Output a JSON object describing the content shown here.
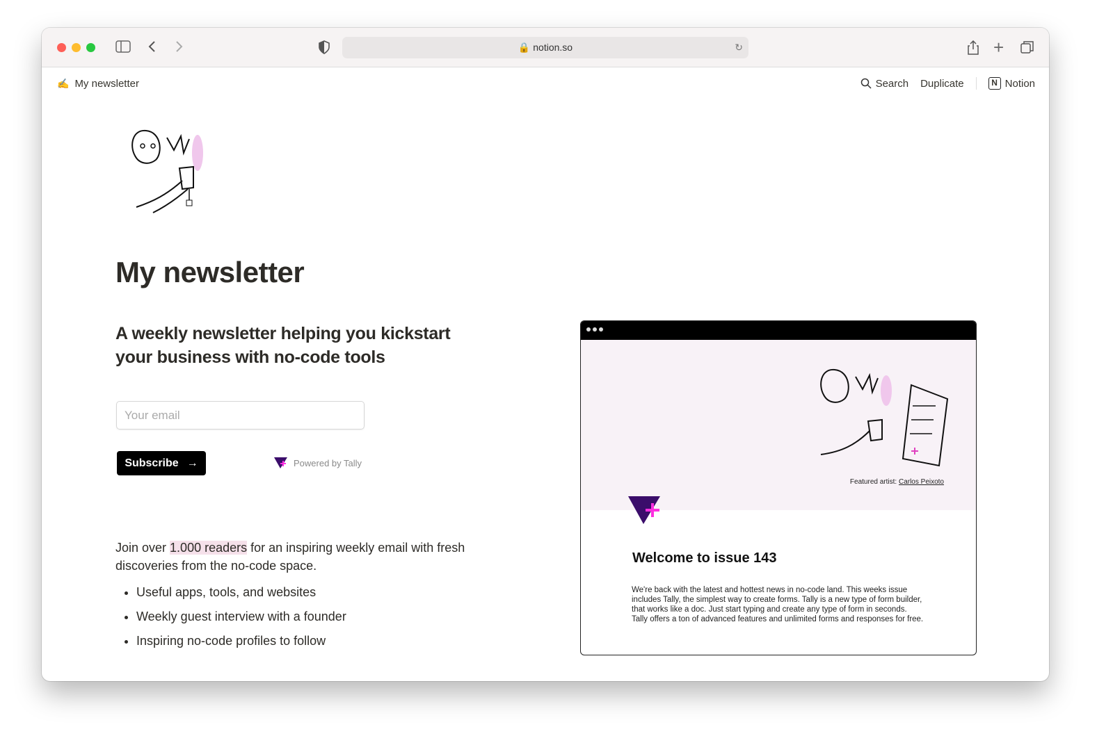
{
  "browser": {
    "url": "notion.so",
    "colors": {
      "close": "#fe5f57",
      "minimize": "#febc2e",
      "maximize": "#28c840"
    }
  },
  "topbar": {
    "page_title": "My newsletter",
    "search_label": "Search",
    "duplicate_label": "Duplicate",
    "notion_label": "Notion"
  },
  "page": {
    "title": "My newsletter",
    "subtitle": "A weekly newsletter helping you kickstart your business with no-code tools",
    "email_placeholder": "Your email",
    "subscribe_label": "Subscribe",
    "powered_by": "Powered by Tally",
    "join_pre": "Join over ",
    "join_highlight": "1.000 readers",
    "join_post": " for an inspiring weekly email with fresh discoveries from the no-code space.",
    "bullets": [
      "Useful apps, tools, and websites",
      "Weekly guest interview with a founder",
      "Inspiring no-code profiles to follow"
    ]
  },
  "preview": {
    "featured_label": "Featured artist:",
    "artist_name": "Carlos Peixoto",
    "title": "Welcome to issue 143",
    "body": "We're back with the latest and hottest news in no-code land. This weeks issue includes Tally, the simplest way to create forms. Tally is a new type of form builder, that works like a doc. Just start typing and create any type of form in seconds. Tally offers a ton of advanced features and  unlimited forms and responses for free.",
    "brand_colors": {
      "tally_purple": "#3b0d6b",
      "tally_pink": "#ff2ee0"
    }
  }
}
